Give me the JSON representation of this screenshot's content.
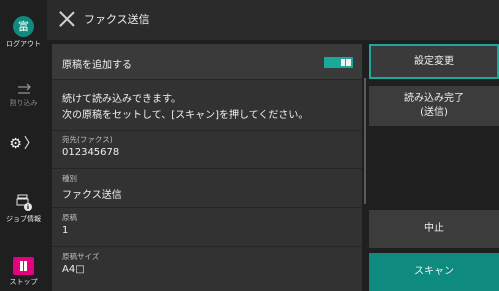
{
  "rail": {
    "logout_badge": "富",
    "logout_label": "ログアウト",
    "interrupt_label": "割り込み",
    "job_label": "ジョブ情報",
    "stop_label": "ストップ",
    "settings_chevron": "〉"
  },
  "header": {
    "title": "ファクス送信"
  },
  "main": {
    "add_original_label": "原稿を追加する",
    "add_original_on": true,
    "message_line1": "続けて読み込みできます。",
    "message_line2": "次の原稿をセットして、[スキャン]を押してください。",
    "fields": [
      {
        "label": "宛先(ファクス)",
        "value": "012345678"
      },
      {
        "label": "種別",
        "value": "ファクス送信"
      },
      {
        "label": "原稿",
        "value": "1"
      },
      {
        "label": "原稿サイズ",
        "value": "A4□"
      }
    ]
  },
  "buttons": {
    "settings": "設定変更",
    "finish_line1": "読み込み完了",
    "finish_line2": "(送信)",
    "cancel": "中止",
    "scan": "スキャン"
  },
  "colors": {
    "accent": "#0e8a7e",
    "toggle": "#19a89a",
    "stop": "#e4007f"
  }
}
